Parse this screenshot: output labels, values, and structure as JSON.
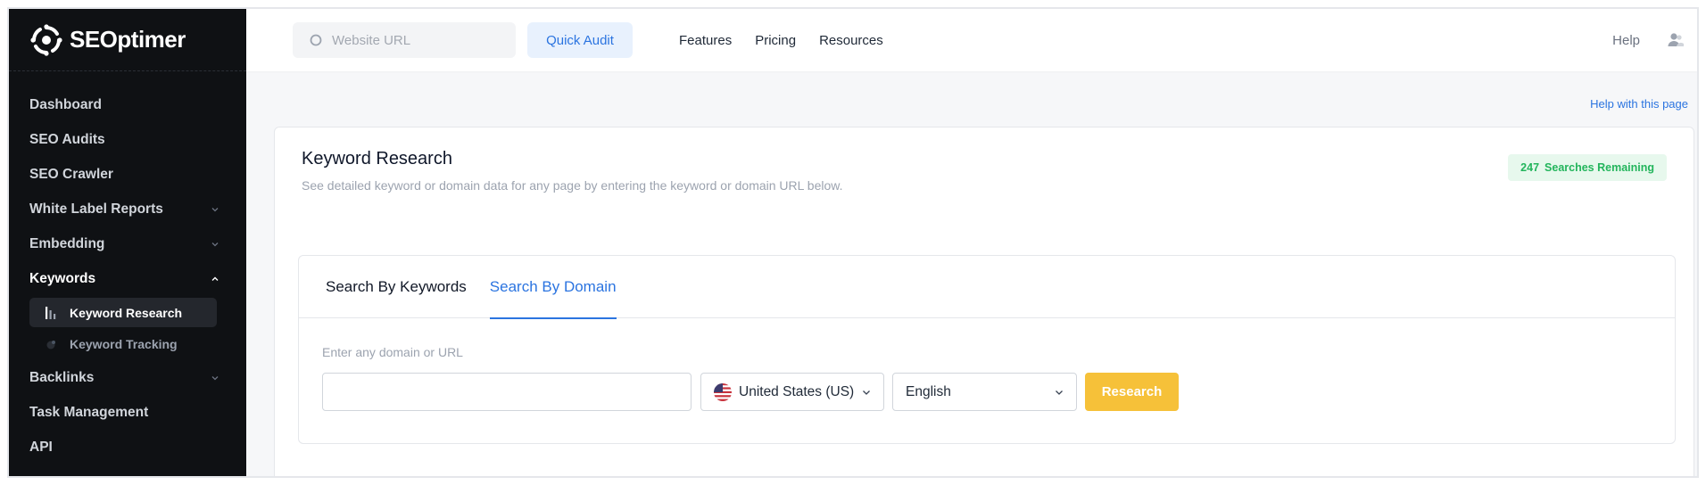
{
  "brand": {
    "name": "SEOptimer"
  },
  "sidebar": {
    "items": [
      {
        "label": "Dashboard",
        "chevron": ""
      },
      {
        "label": "SEO Audits",
        "chevron": ""
      },
      {
        "label": "SEO Crawler",
        "chevron": ""
      },
      {
        "label": "White Label Reports",
        "chevron": "down"
      },
      {
        "label": "Embedding",
        "chevron": "down"
      },
      {
        "label": "Keywords",
        "chevron": "up"
      },
      {
        "label": "Backlinks",
        "chevron": "down"
      },
      {
        "label": "Task Management",
        "chevron": ""
      },
      {
        "label": "API",
        "chevron": ""
      }
    ],
    "keyword_sub": [
      {
        "label": "Keyword Research",
        "icon": "bar-chart-icon",
        "current": true
      },
      {
        "label": "Keyword Tracking",
        "icon": "tracking-icon",
        "current": false
      }
    ]
  },
  "topbar": {
    "url_placeholder": "Website URL",
    "quick_audit": "Quick Audit",
    "links": [
      "Features",
      "Pricing",
      "Resources"
    ],
    "help": "Help"
  },
  "page": {
    "help_link": "Help with this page",
    "title": "Keyword Research",
    "subtitle": "See detailed keyword or domain data for any page by entering the keyword or domain URL below.",
    "searches_count": "247",
    "searches_label": "Searches Remaining",
    "tabs": [
      "Search By Keywords",
      "Search By Domain"
    ],
    "active_tab": 1,
    "field_label": "Enter any domain or URL",
    "domain_value": "",
    "country": "United States (US)",
    "language": "English",
    "research_button": "Research"
  },
  "colors": {
    "sidebar_bg": "#0f1114",
    "accent_blue": "#2b74e0",
    "research_yellow": "#f6c139",
    "badge_green": "#23b55c"
  }
}
